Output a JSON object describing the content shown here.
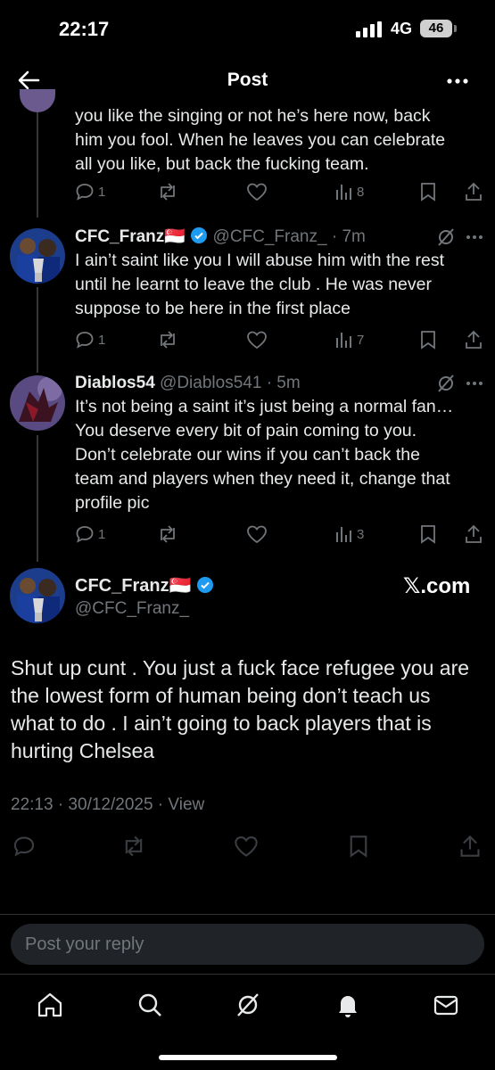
{
  "status_bar": {
    "time": "22:17",
    "network": "4G",
    "battery": "46"
  },
  "nav": {
    "title": "Post"
  },
  "tweets": [
    {
      "body": "you like the singing or not he’s here now, back\nhim you fool. When he leaves you can celebrate\nall you like, but back the fucking team.",
      "replies": "1",
      "views": "8"
    },
    {
      "name": "CFC_Franz",
      "flag": "🇸🇬",
      "handle": "@CFC_Franz_",
      "time": "· 7m",
      "body": "I ain’t saint like you I will abuse him with the rest\nuntil he learnt to leave the club . He was never\nsuppose to be here in the first place",
      "replies": "1",
      "views": "7"
    },
    {
      "name": "Diablos54",
      "handle": "@Diablos541",
      "time": "· 5m",
      "body": "It’s not being a saint it’s just being a normal fan…\nYou deserve every bit of pain coming to you.\nDon’t celebrate our wins if you can’t back the\nteam and players when they need it, change that\nprofile pic",
      "replies": "1",
      "views": "3"
    }
  ],
  "main_post": {
    "name": "CFC_Franz",
    "handle": "@CFC_Franz_",
    "watermark": "𝕏.com",
    "body": "Shut up cunt . You just a fuck face refugee you are\nthe lowest form of human being don’t teach us\nwhat to do . I ain’t going to back players that is\nhurting Chelsea",
    "timestamp": "22:13 · 30/12/2025 · ",
    "view_link": "View"
  },
  "reply_box": {
    "placeholder": "Post your reply"
  },
  "colors": {
    "background": "#000000",
    "text": "#e7e9ea",
    "muted": "#71767b",
    "verified": "#1d9bf0"
  }
}
